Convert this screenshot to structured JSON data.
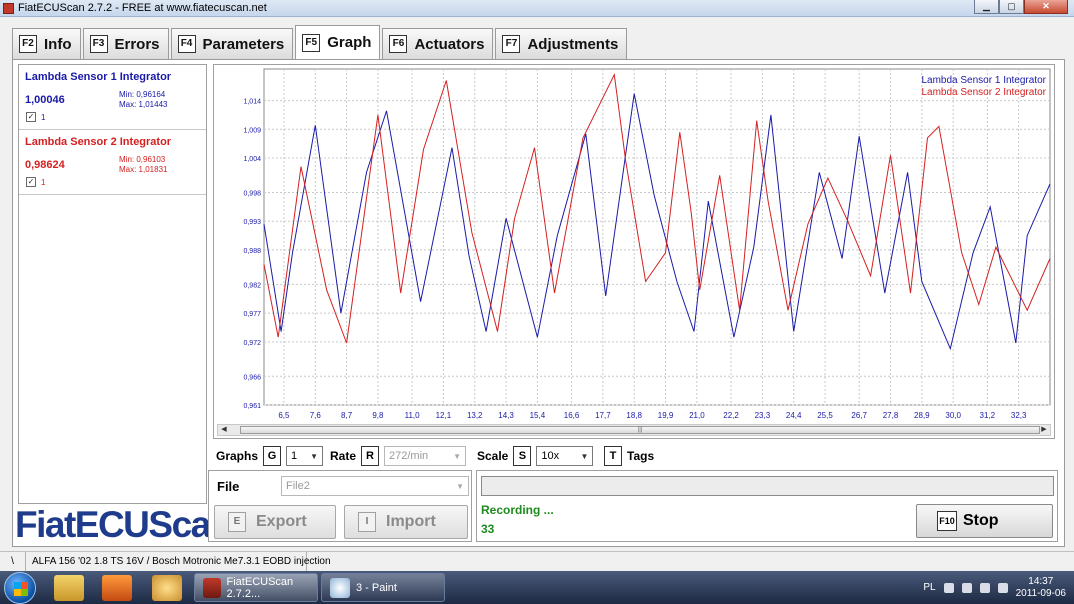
{
  "window": {
    "title": "FiatECUScan 2.7.2 - FREE at www.fiatecuscan.net",
    "min_label": "▁",
    "max_label": "▢",
    "close_label": "✕"
  },
  "tabs": [
    {
      "key": "F2",
      "label": "Info"
    },
    {
      "key": "F3",
      "label": "Errors"
    },
    {
      "key": "F4",
      "label": "Parameters"
    },
    {
      "key": "F5",
      "label": "Graph"
    },
    {
      "key": "F6",
      "label": "Actuators"
    },
    {
      "key": "F7",
      "label": "Adjustments"
    }
  ],
  "active_tab": "Graph",
  "sensors": [
    {
      "name": "Lambda Sensor 1 Integrator",
      "value": "1,00046",
      "min": "Min: 0,96164",
      "max": "Max: 1,01443",
      "checked": true,
      "check_label": "1",
      "color": "#1a1aa8"
    },
    {
      "name": "Lambda Sensor 2 Integrator",
      "value": "0,98624",
      "min": "Min: 0,96103",
      "max": "Max: 1,01831",
      "checked": true,
      "check_label": "1",
      "color": "#d42020"
    }
  ],
  "logo": "FiatECUScan",
  "chart_data": {
    "type": "line",
    "title": "",
    "xlabel": "",
    "ylabel": "",
    "x_ticks": [
      "6,5",
      "7,6",
      "8,7",
      "9,8",
      "11,0",
      "12,1",
      "13,2",
      "14,3",
      "15,4",
      "16,6",
      "17,7",
      "18,8",
      "19,9",
      "21,0",
      "22,2",
      "23,3",
      "24,4",
      "25,5",
      "26,7",
      "27,8",
      "28,9",
      "30,0",
      "31,2",
      "32,3"
    ],
    "y_ticks": [
      "0,961",
      "0,966",
      "0,972",
      "0,977",
      "0,982",
      "0,988",
      "0,993",
      "0,998",
      "1,004",
      "1,009",
      "1,014"
    ],
    "xlim": [
      5.8,
      33.4
    ],
    "ylim": [
      0.961,
      1.0195
    ],
    "grid": true,
    "legend": "top-right",
    "series": [
      {
        "name": "Lambda Sensor 1 Integrator",
        "color": "#1a1aa8",
        "x": [
          5.8,
          6.4,
          6.8,
          7.6,
          8.5,
          9.4,
          10.1,
          11.3,
          12.4,
          13.0,
          13.6,
          14.3,
          15.4,
          16.1,
          17.1,
          17.8,
          18.8,
          19.5,
          20.3,
          20.9,
          21.4,
          22.3,
          23.0,
          23.6,
          24.4,
          25.3,
          26.1,
          26.7,
          27.6,
          28.4,
          28.9,
          29.9,
          30.7,
          31.3,
          32.2,
          32.6,
          33.4
        ],
        "y": [
          0.9925,
          0.9738,
          0.9875,
          1.0097,
          0.977,
          1.0015,
          1.0122,
          0.979,
          1.0058,
          0.987,
          0.9738,
          0.9935,
          0.9728,
          0.9905,
          1.0082,
          0.98,
          1.0152,
          0.9975,
          0.9825,
          0.9738,
          0.9965,
          0.9728,
          0.9885,
          1.0115,
          0.9738,
          1.0015,
          0.9865,
          1.0078,
          0.9805,
          1.0015,
          0.9825,
          0.9708,
          0.9875,
          0.9955,
          0.9718,
          0.9905,
          0.9995
        ]
      },
      {
        "name": "Lambda Sensor 2 Integrator",
        "color": "#d42020",
        "x": [
          5.8,
          6.3,
          7.1,
          8.0,
          8.7,
          9.8,
          10.6,
          11.4,
          12.2,
          13.1,
          14.0,
          14.6,
          15.3,
          16.0,
          17.0,
          18.1,
          18.5,
          19.2,
          19.9,
          20.4,
          20.8,
          21.1,
          21.8,
          22.5,
          23.1,
          23.5,
          24.2,
          24.9,
          25.6,
          26.3,
          27.1,
          27.8,
          28.5,
          29.1,
          29.5,
          30.3,
          30.9,
          31.5,
          32.6,
          33.4
        ],
        "y": [
          0.9855,
          0.9728,
          1.0025,
          0.981,
          0.9718,
          1.0115,
          0.9805,
          1.0055,
          1.0175,
          0.991,
          0.9738,
          0.9935,
          1.0058,
          0.9805,
          1.0075,
          1.0185,
          1.0035,
          0.9825,
          0.9875,
          1.0085,
          0.9945,
          0.981,
          1.001,
          0.9775,
          1.0105,
          0.9965,
          0.9775,
          0.9925,
          1.0005,
          0.993,
          0.9835,
          1.0045,
          0.9805,
          1.0075,
          1.0095,
          0.9875,
          0.9785,
          0.9885,
          0.9775,
          0.9865
        ]
      }
    ]
  },
  "controls": {
    "graphs_label": "Graphs",
    "graphs_key": "G",
    "graphs_value": "1",
    "rate_label": "Rate",
    "rate_key": "R",
    "rate_value": "272/min",
    "scale_label": "Scale",
    "scale_key": "S",
    "scale_value": "10x",
    "tags_key": "T",
    "tags_label": "Tags"
  },
  "file": {
    "label": "File",
    "value": "File2",
    "export_key": "E",
    "export_label": "Export",
    "import_key": "I",
    "import_label": "Import"
  },
  "recording": {
    "status": "Recording ...",
    "count": "33",
    "stop_key": "F10",
    "stop_label": "Stop"
  },
  "statusbar": {
    "seg1": "\\",
    "vehicle": "ALFA 156 '02 1.8 TS 16V / Bosch Motronic Me7.3.1 EOBD injection"
  },
  "taskbar": {
    "tasks": [
      "FiatECUScan 2.7.2...",
      "3 - Paint"
    ],
    "lang": "PL",
    "time": "14:37",
    "date": "2011-09-06"
  }
}
